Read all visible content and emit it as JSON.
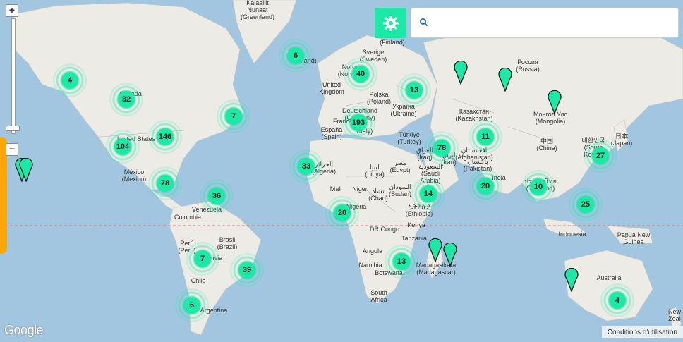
{
  "map": {
    "search_placeholder": "",
    "attribution": "Google",
    "terms": "Conditions d'utilisation",
    "colors": {
      "cluster": "#1de9a6",
      "accent_bar": "#ffa600",
      "water": "#a3c6e0",
      "land": "#ecebe6"
    },
    "icons": {
      "settings": "gear-icon",
      "search": "search-icon",
      "zoom_in": "plus-icon",
      "zoom_out": "minus-icon"
    }
  },
  "labels": [
    {
      "id": "kalaallit",
      "text": "Kalaallit\nNunaat\n(Greenland)"
    },
    {
      "id": "ireland",
      "text": "(Ireland)"
    },
    {
      "id": "sverige",
      "text": "Sverige\n(Sweden)"
    },
    {
      "id": "norge",
      "text": "Norge\n(Norway)"
    },
    {
      "id": "finland",
      "text": "(Finland)"
    },
    {
      "id": "rossiya",
      "text": "Россия\n(Russia)"
    },
    {
      "id": "uk",
      "text": "United\nKingdom"
    },
    {
      "id": "polska",
      "text": "Polska\n(Poland)"
    },
    {
      "id": "ukraina",
      "text": "Україна\n(Ukraine)"
    },
    {
      "id": "germany",
      "text": "Deutschland\n(Germany)"
    },
    {
      "id": "france",
      "text": "France"
    },
    {
      "id": "italy",
      "text": "(Italy)"
    },
    {
      "id": "espana",
      "text": "España\n(Spain)"
    },
    {
      "id": "turkiye",
      "text": "Türkiye\n(Turkey)"
    },
    {
      "id": "kazakhstan",
      "text": "Казахстан\n(Kazakhstan)"
    },
    {
      "id": "mongolia",
      "text": "Монгол Улс\n(Mongolia)"
    },
    {
      "id": "china",
      "text": "中国\n(China)"
    },
    {
      "id": "japan",
      "text": "日本\n(Japan)"
    },
    {
      "id": "korea",
      "text": "대한민국\n(South\nKorea)"
    },
    {
      "id": "iraq",
      "text": "العراق\n(Iraq)"
    },
    {
      "id": "iran",
      "text": "ایران\n(Iran)"
    },
    {
      "id": "afghanistan",
      "text": "افغانستان\n(Afghanistan)"
    },
    {
      "id": "pakistan",
      "text": "پاکستان\n(Pakistan)"
    },
    {
      "id": "india",
      "text": "India"
    },
    {
      "id": "thailand",
      "text": "ประเทศไทย\n(Thailand)"
    },
    {
      "id": "canada",
      "text": "Canada"
    },
    {
      "id": "us",
      "text": "United States"
    },
    {
      "id": "mexico",
      "text": "México\n(Mexico)"
    },
    {
      "id": "venezuela",
      "text": "Venezuela"
    },
    {
      "id": "colombia",
      "text": "Colombia"
    },
    {
      "id": "peru",
      "text": "Perú\n(Peru)"
    },
    {
      "id": "brasil",
      "text": "Brasil\n(Brazil)"
    },
    {
      "id": "bolivia",
      "text": "Bolivia"
    },
    {
      "id": "chile",
      "text": "Chile"
    },
    {
      "id": "argentina",
      "text": "Argentina"
    },
    {
      "id": "algeria",
      "text": "الجزائر\n(Algeria)"
    },
    {
      "id": "libya",
      "text": "ليبيا\n(Libya)"
    },
    {
      "id": "egypt",
      "text": "مصر\n(Egypt)"
    },
    {
      "id": "saudi",
      "text": "السعودية\n(Saudi\nArabia)"
    },
    {
      "id": "mali",
      "text": "Mali"
    },
    {
      "id": "niger",
      "text": "Niger"
    },
    {
      "id": "chad",
      "text": "تشاد\n(Chad)"
    },
    {
      "id": "sudan",
      "text": "السودان\n(Sudan)"
    },
    {
      "id": "ethiopia",
      "text": "ኢትዮጵያ\n(Ethiopia)"
    },
    {
      "id": "nigeria",
      "text": "Nigeria"
    },
    {
      "id": "drcongo",
      "text": "DR Congo"
    },
    {
      "id": "kenya",
      "text": "Kenya"
    },
    {
      "id": "tanzania",
      "text": "Tanzania"
    },
    {
      "id": "angola",
      "text": "Angola"
    },
    {
      "id": "namibia",
      "text": "Namibia"
    },
    {
      "id": "botswana",
      "text": "Botswana"
    },
    {
      "id": "madagascar",
      "text": "Madagasikara\n(Madagascar)"
    },
    {
      "id": "southafrica",
      "text": "South\nAfrica"
    },
    {
      "id": "indonesia",
      "text": "Indonesia"
    },
    {
      "id": "png",
      "text": "Papua New\nGuinea"
    },
    {
      "id": "australia",
      "text": "Australia"
    },
    {
      "id": "newzealand",
      "text": "New\nZeal"
    }
  ],
  "clusters": [
    {
      "id": "c-alaska",
      "count": "4"
    },
    {
      "id": "c-canada",
      "count": "32"
    },
    {
      "id": "c-iceland",
      "count": "6"
    },
    {
      "id": "c-newfoundland",
      "count": "7"
    },
    {
      "id": "c-us-west",
      "count": "104"
    },
    {
      "id": "c-us-east",
      "count": "146"
    },
    {
      "id": "c-mexico",
      "count": "78"
    },
    {
      "id": "c-caribbean",
      "count": "36"
    },
    {
      "id": "c-peru",
      "count": "7"
    },
    {
      "id": "c-brazil",
      "count": "39"
    },
    {
      "id": "c-argentina",
      "count": "6"
    },
    {
      "id": "c-scandinavia",
      "count": "40"
    },
    {
      "id": "c-europe",
      "count": "193"
    },
    {
      "id": "c-eastern-europe",
      "count": "13"
    },
    {
      "id": "c-morocco",
      "count": "33"
    },
    {
      "id": "c-middle-east",
      "count": "78"
    },
    {
      "id": "c-central-asia",
      "count": "11"
    },
    {
      "id": "c-india",
      "count": "20"
    },
    {
      "id": "c-east-africa",
      "count": "14"
    },
    {
      "id": "c-west-africa",
      "count": "20"
    },
    {
      "id": "c-south-africa",
      "count": "13"
    },
    {
      "id": "c-southeast-asia",
      "count": "10"
    },
    {
      "id": "c-philippines",
      "count": "25"
    },
    {
      "id": "c-japan",
      "count": "27"
    },
    {
      "id": "c-australia",
      "count": "4"
    }
  ]
}
